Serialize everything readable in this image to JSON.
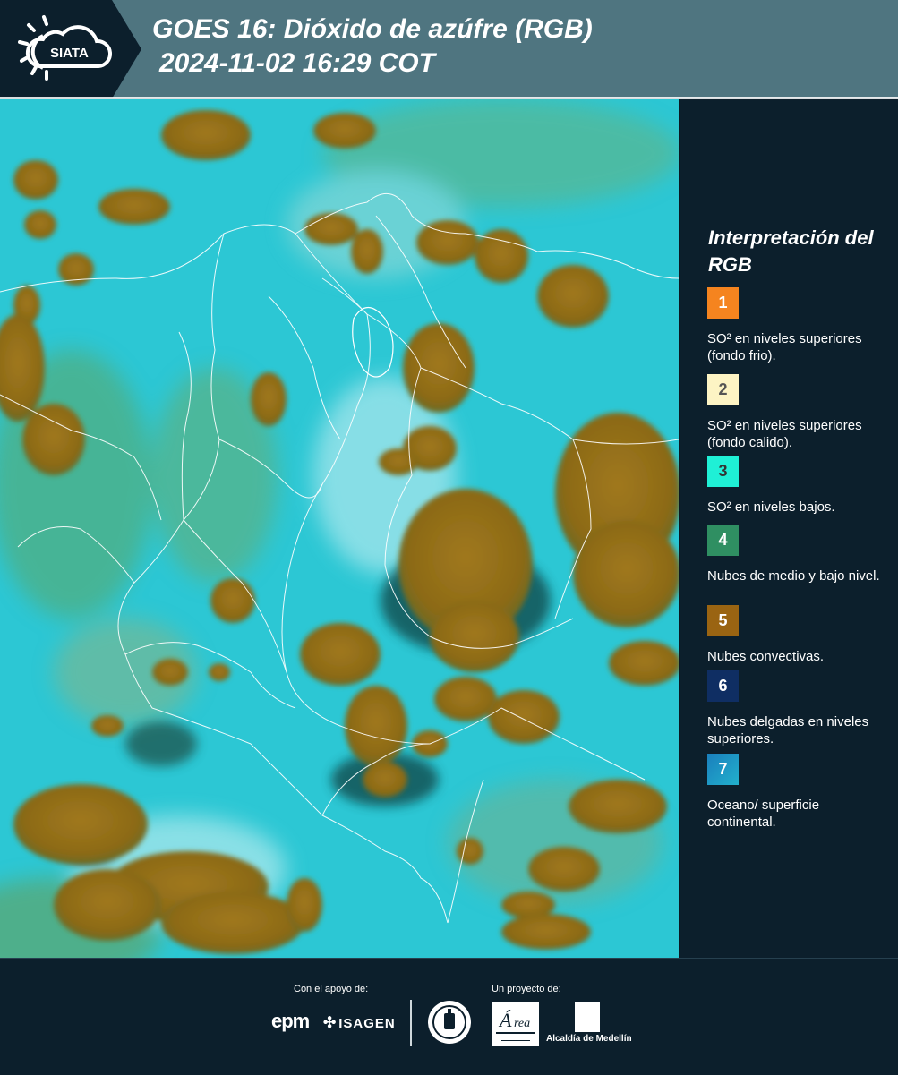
{
  "header": {
    "logo_text": "SIATA",
    "title_line1": "GOES 16: Dióxido de azúfre (RGB)",
    "title_line2": "2024-11-02 16:29 COT"
  },
  "legend": {
    "title": "Interpretación del RGB",
    "items": [
      {
        "number": "1",
        "label": "SO² en niveles superiores (fondo frio).",
        "color": "#f5841f"
      },
      {
        "number": "2",
        "label": "SO² en niveles superiores (fondo calido).",
        "color": "#fdf4c4"
      },
      {
        "number": "3",
        "label": "SO² en niveles bajos.",
        "color": "#1ff0d6"
      },
      {
        "number": "4",
        "label": "Nubes de medio y bajo nivel.",
        "color": "#2f8f62"
      },
      {
        "number": "5",
        "label": "Nubes convectivas.",
        "color": "#9a6412"
      },
      {
        "number": "6",
        "label": "Nubes delgadas en niveles superiores.",
        "color": "#0f2e63"
      },
      {
        "number": "7",
        "label": "Oceano/ superficie continental.",
        "color": "#1990c4"
      }
    ]
  },
  "footer": {
    "support_caption": "Con el apoyo de:",
    "project_caption": "Un proyecto de:",
    "sponsor_1": "epm",
    "sponsor_2": "ISAGEN",
    "partner_1": "Área Metropolitana Valle de Aburrá",
    "partner_2": "Alcaldía de Medellín"
  }
}
